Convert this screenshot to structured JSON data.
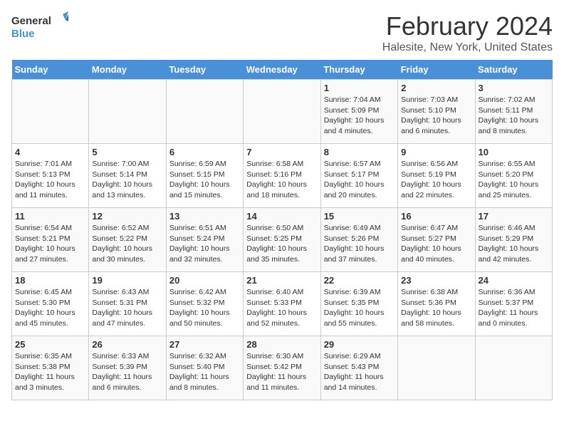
{
  "logo": {
    "general": "General",
    "blue": "Blue"
  },
  "title": "February 2024",
  "subtitle": "Halesite, New York, United States",
  "days_of_week": [
    "Sunday",
    "Monday",
    "Tuesday",
    "Wednesday",
    "Thursday",
    "Friday",
    "Saturday"
  ],
  "weeks": [
    [
      {
        "day": "",
        "info": ""
      },
      {
        "day": "",
        "info": ""
      },
      {
        "day": "",
        "info": ""
      },
      {
        "day": "",
        "info": ""
      },
      {
        "day": "1",
        "info": "Sunrise: 7:04 AM\nSunset: 5:09 PM\nDaylight: 10 hours\nand 4 minutes."
      },
      {
        "day": "2",
        "info": "Sunrise: 7:03 AM\nSunset: 5:10 PM\nDaylight: 10 hours\nand 6 minutes."
      },
      {
        "day": "3",
        "info": "Sunrise: 7:02 AM\nSunset: 5:11 PM\nDaylight: 10 hours\nand 8 minutes."
      }
    ],
    [
      {
        "day": "4",
        "info": "Sunrise: 7:01 AM\nSunset: 5:13 PM\nDaylight: 10 hours\nand 11 minutes."
      },
      {
        "day": "5",
        "info": "Sunrise: 7:00 AM\nSunset: 5:14 PM\nDaylight: 10 hours\nand 13 minutes."
      },
      {
        "day": "6",
        "info": "Sunrise: 6:59 AM\nSunset: 5:15 PM\nDaylight: 10 hours\nand 15 minutes."
      },
      {
        "day": "7",
        "info": "Sunrise: 6:58 AM\nSunset: 5:16 PM\nDaylight: 10 hours\nand 18 minutes."
      },
      {
        "day": "8",
        "info": "Sunrise: 6:57 AM\nSunset: 5:17 PM\nDaylight: 10 hours\nand 20 minutes."
      },
      {
        "day": "9",
        "info": "Sunrise: 6:56 AM\nSunset: 5:19 PM\nDaylight: 10 hours\nand 22 minutes."
      },
      {
        "day": "10",
        "info": "Sunrise: 6:55 AM\nSunset: 5:20 PM\nDaylight: 10 hours\nand 25 minutes."
      }
    ],
    [
      {
        "day": "11",
        "info": "Sunrise: 6:54 AM\nSunset: 5:21 PM\nDaylight: 10 hours\nand 27 minutes."
      },
      {
        "day": "12",
        "info": "Sunrise: 6:52 AM\nSunset: 5:22 PM\nDaylight: 10 hours\nand 30 minutes."
      },
      {
        "day": "13",
        "info": "Sunrise: 6:51 AM\nSunset: 5:24 PM\nDaylight: 10 hours\nand 32 minutes."
      },
      {
        "day": "14",
        "info": "Sunrise: 6:50 AM\nSunset: 5:25 PM\nDaylight: 10 hours\nand 35 minutes."
      },
      {
        "day": "15",
        "info": "Sunrise: 6:49 AM\nSunset: 5:26 PM\nDaylight: 10 hours\nand 37 minutes."
      },
      {
        "day": "16",
        "info": "Sunrise: 6:47 AM\nSunset: 5:27 PM\nDaylight: 10 hours\nand 40 minutes."
      },
      {
        "day": "17",
        "info": "Sunrise: 6:46 AM\nSunset: 5:29 PM\nDaylight: 10 hours\nand 42 minutes."
      }
    ],
    [
      {
        "day": "18",
        "info": "Sunrise: 6:45 AM\nSunset: 5:30 PM\nDaylight: 10 hours\nand 45 minutes."
      },
      {
        "day": "19",
        "info": "Sunrise: 6:43 AM\nSunset: 5:31 PM\nDaylight: 10 hours\nand 47 minutes."
      },
      {
        "day": "20",
        "info": "Sunrise: 6:42 AM\nSunset: 5:32 PM\nDaylight: 10 hours\nand 50 minutes."
      },
      {
        "day": "21",
        "info": "Sunrise: 6:40 AM\nSunset: 5:33 PM\nDaylight: 10 hours\nand 52 minutes."
      },
      {
        "day": "22",
        "info": "Sunrise: 6:39 AM\nSunset: 5:35 PM\nDaylight: 10 hours\nand 55 minutes."
      },
      {
        "day": "23",
        "info": "Sunrise: 6:38 AM\nSunset: 5:36 PM\nDaylight: 10 hours\nand 58 minutes."
      },
      {
        "day": "24",
        "info": "Sunrise: 6:36 AM\nSunset: 5:37 PM\nDaylight: 11 hours\nand 0 minutes."
      }
    ],
    [
      {
        "day": "25",
        "info": "Sunrise: 6:35 AM\nSunset: 5:38 PM\nDaylight: 11 hours\nand 3 minutes."
      },
      {
        "day": "26",
        "info": "Sunrise: 6:33 AM\nSunset: 5:39 PM\nDaylight: 11 hours\nand 6 minutes."
      },
      {
        "day": "27",
        "info": "Sunrise: 6:32 AM\nSunset: 5:40 PM\nDaylight: 11 hours\nand 8 minutes."
      },
      {
        "day": "28",
        "info": "Sunrise: 6:30 AM\nSunset: 5:42 PM\nDaylight: 11 hours\nand 11 minutes."
      },
      {
        "day": "29",
        "info": "Sunrise: 6:29 AM\nSunset: 5:43 PM\nDaylight: 11 hours\nand 14 minutes."
      },
      {
        "day": "",
        "info": ""
      },
      {
        "day": "",
        "info": ""
      }
    ]
  ]
}
